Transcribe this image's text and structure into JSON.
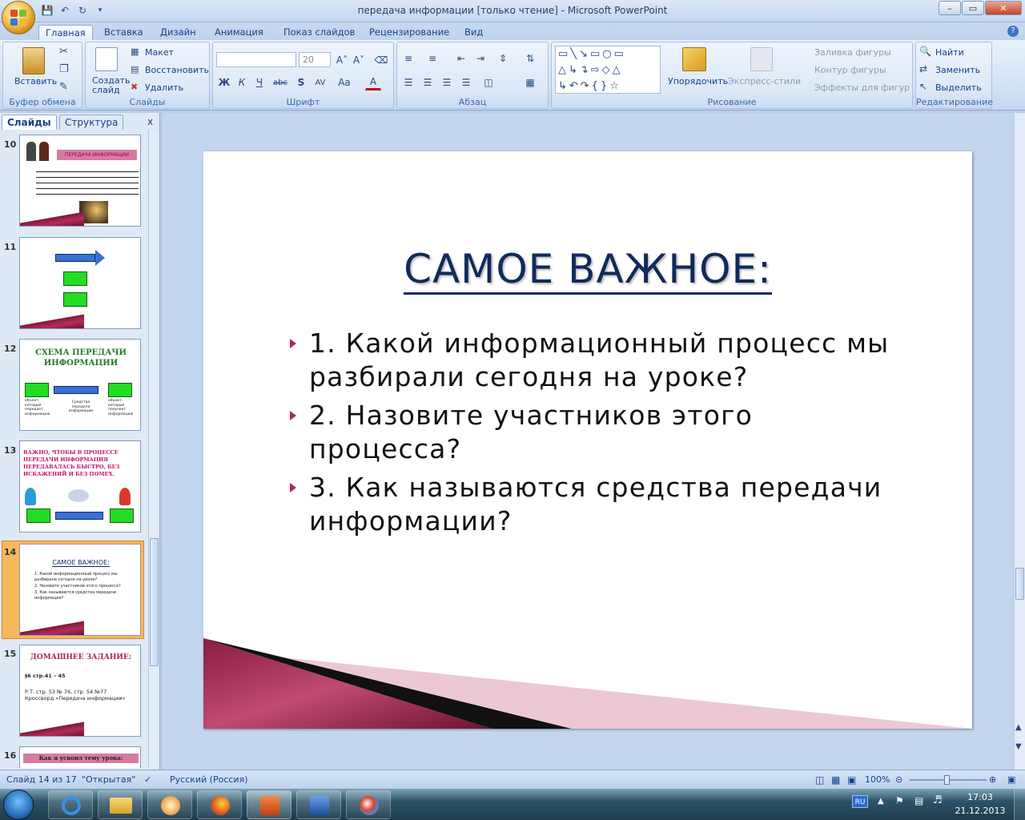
{
  "window": {
    "title": "передача информации  [только чтение] - Microsoft PowerPoint",
    "min_label": "–",
    "max_label": "▭",
    "close_label": "✕"
  },
  "qat": {
    "save_icon": "save-icon",
    "undo_icon": "undo-icon",
    "redo_icon": "redo-icon"
  },
  "tabs": [
    {
      "label": "Главная"
    },
    {
      "label": "Вставка"
    },
    {
      "label": "Дизайн"
    },
    {
      "label": "Анимация"
    },
    {
      "label": "Показ слайдов"
    },
    {
      "label": "Рецензирование"
    },
    {
      "label": "Вид"
    }
  ],
  "ribbon": {
    "clipboard": {
      "title": "Буфер обмена",
      "paste": "Вставить"
    },
    "slides": {
      "title": "Слайды",
      "create": "Создать\nслайд",
      "layout": "Макет",
      "reset": "Восстановить",
      "delete": "Удалить"
    },
    "font": {
      "title": "Шрифт",
      "size": "20",
      "bold": "Ж",
      "italic": "К",
      "underline": "Ч",
      "strike": "abc",
      "shadow": "S",
      "spacing": "AV",
      "case": "Aa",
      "color": "A"
    },
    "paragraph": {
      "title": "Абзац"
    },
    "drawing": {
      "title": "Рисование",
      "arrange": "Упорядочить",
      "quick_styles": "Экспресс-стили",
      "fill": "Заливка фигуры",
      "outline": "Контур фигуры",
      "effects": "Эффекты для фигур"
    },
    "editing": {
      "title": "Редактирование",
      "find": "Найти",
      "replace": "Заменить",
      "select": "Выделить"
    }
  },
  "panel": {
    "tab_slides": "Слайды",
    "tab_outline": "Структура",
    "close": "x",
    "thumbs": [
      {
        "num": "10",
        "title": "ПЕРЕДАЧА ИНФОРМАЦИИ"
      },
      {
        "num": "11"
      },
      {
        "num": "12",
        "title": "СХЕМА ПЕРЕДАЧИ ИНФОРМАЦИИ",
        "c1": "объект, который передает информацию",
        "c2": "Средства передачи информации",
        "c3": "объект, который получает информацию"
      },
      {
        "num": "13",
        "text": "ВАЖНО, ЧТОБЫ В ПРОЦЕССЕ ПЕРЕДАЧИ ИНФОРМАЦИЯ ПЕРЕДАВАЛАСЬ  БЫСТРО, БЕЗ ИСКАЖЕНИЙ И БЕЗ ПОМЕХ."
      },
      {
        "num": "14",
        "title": "САМОЕ ВАЖНОЕ:",
        "b1": "1. Какой информационный процесс мы разбирали сегодня на уроке?",
        "b2": "2. Назовите участников этого процесса?",
        "b3": "3. Как называются средства передачи информации?"
      },
      {
        "num": "15",
        "title": "ДОМАШНЕЕ ЗАДАНИЕ:",
        "l1": "§6 стр.41 – 45",
        "l2": "Р.Т. стр. 53 № 76, стр. 54 №77 Кроссворд «Передача информации»"
      },
      {
        "num": "16",
        "title": "Как  я усвоил тему урока:"
      }
    ]
  },
  "slide": {
    "title": "САМОЕ ВАЖНОЕ:",
    "bullets": [
      "1. Какой информационный процесс мы разбирали сегодня на уроке?",
      "2. Назовите участников этого процесса?",
      "3. Как называются средства передачи информации?"
    ]
  },
  "status": {
    "slide": "Слайд 14 из 17",
    "theme": "\"Открытая\"",
    "language": "Русский (Россия)",
    "zoom": "100%"
  },
  "taskbar": {
    "lang": "RU",
    "time": "17:03",
    "date": "21.12.2013"
  },
  "colors": {
    "accent": "#b0284f",
    "title": "#102a5c",
    "ribbon": "#d1e1f4"
  }
}
